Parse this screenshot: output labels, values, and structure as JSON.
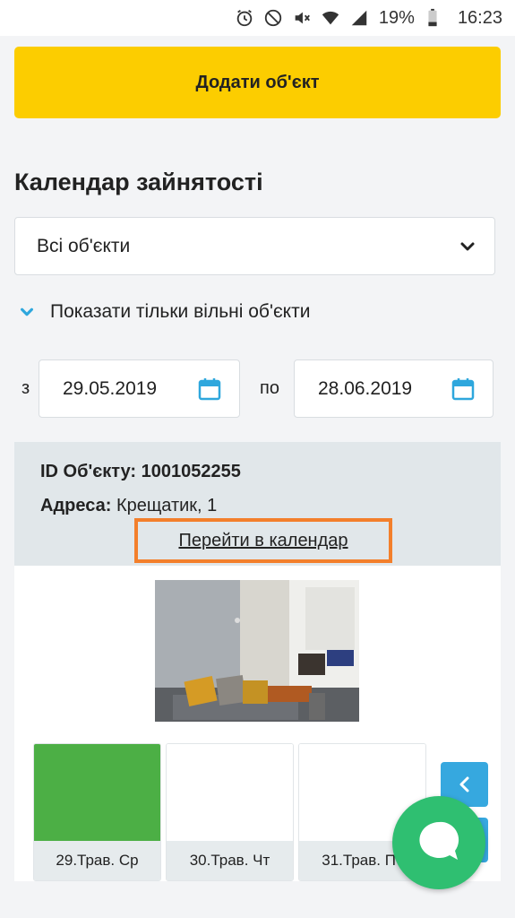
{
  "status_bar": {
    "battery_percent": "19%",
    "time": "16:23"
  },
  "add_object_button": "Додати об'єкт",
  "calendar": {
    "title": "Календар зайнятості",
    "object_select": {
      "selected": "Всі об'єкти"
    },
    "free_only": {
      "label": "Показати тільки вільні об'єкти",
      "checked": true
    },
    "date_from_label": "з",
    "date_from": "29.05.2019",
    "date_to_label": "по",
    "date_to": "28.06.2019"
  },
  "object": {
    "id_label": "ID Об'єкту:",
    "id_value": "1001052255",
    "address_label": "Адреса:",
    "address_value": "Крещатик, 1",
    "calendar_link": "Перейти в календар",
    "days": [
      {
        "label": "29.Трав. Ср",
        "status": "free",
        "color": "#4caf45"
      },
      {
        "label": "30.Трав. Чт",
        "status": "empty",
        "color": "#ffffff"
      },
      {
        "label": "31.Трав. Пт",
        "status": "empty",
        "color": "#ffffff"
      }
    ]
  },
  "icons": {
    "alarm": "alarm-icon",
    "dnd": "do-not-disturb-icon",
    "mute": "mute-icon",
    "wifi": "wifi-icon",
    "signal": "signal-icon",
    "battery": "battery-icon",
    "calendar": "calendar-icon",
    "chevron": "chevron-down-icon",
    "prev": "chevron-left-icon",
    "chat": "chat-icon"
  },
  "colors": {
    "accent_yellow": "#fccd00",
    "highlight_orange": "#f37f2b",
    "free_green": "#4caf45",
    "nav_blue": "#36a8df",
    "chat_green": "#2fbf71",
    "icon_teal": "#2ea7dd"
  }
}
